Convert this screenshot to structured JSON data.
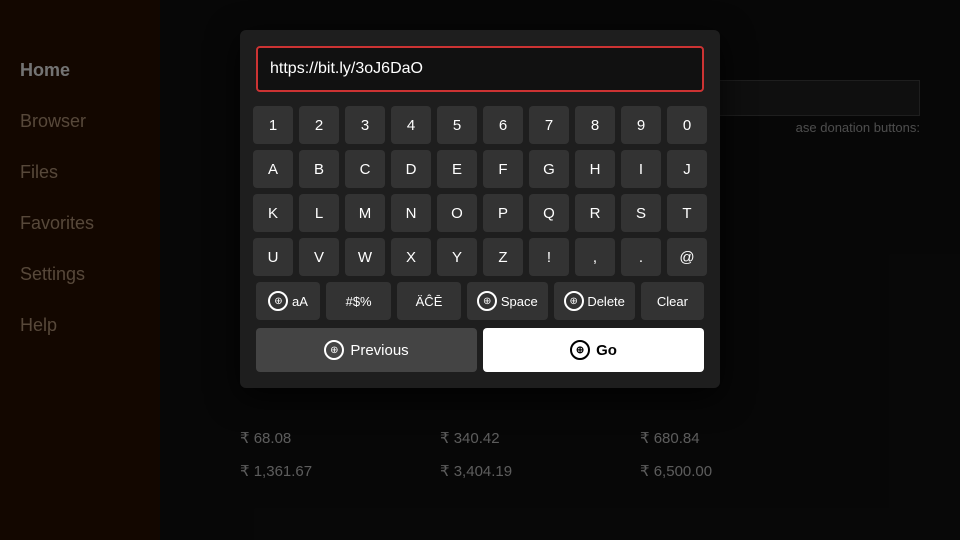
{
  "sidebar": {
    "items": [
      {
        "label": "Home",
        "active": true
      },
      {
        "label": "Browser",
        "active": false
      },
      {
        "label": "Files",
        "active": false
      },
      {
        "label": "Favorites",
        "active": false
      },
      {
        "label": "Settings",
        "active": false
      },
      {
        "label": "Help",
        "active": false
      }
    ]
  },
  "background": {
    "donation_label": "ase donation buttons:",
    "prices": [
      "₹ 68.08",
      "₹ 340.42",
      "₹ 680.84",
      "₹ 1,361.67",
      "₹ 3,404.19",
      "₹ 6,500.00"
    ]
  },
  "dialog": {
    "url_value": "https://bit.ly/3oJ6DaO",
    "keyboard": {
      "row1": [
        "1",
        "2",
        "3",
        "4",
        "5",
        "6",
        "7",
        "8",
        "9",
        "0"
      ],
      "row2": [
        "A",
        "B",
        "C",
        "D",
        "E",
        "F",
        "G",
        "H",
        "I",
        "J"
      ],
      "row3": [
        "K",
        "L",
        "M",
        "N",
        "O",
        "P",
        "Q",
        "R",
        "S",
        "T"
      ],
      "row4": [
        "U",
        "V",
        "W",
        "X",
        "Y",
        "Z",
        "!",
        ",",
        ".",
        "@"
      ],
      "special_keys": [
        {
          "label": "⊕ aA",
          "id": "case-toggle"
        },
        {
          "label": "#$%",
          "id": "symbols"
        },
        {
          "label": "ÄĈĒ",
          "id": "accents"
        },
        {
          "label": "⊕ Space",
          "id": "space"
        },
        {
          "label": "⊕ Delete",
          "id": "delete"
        },
        {
          "label": "Clear",
          "id": "clear"
        }
      ]
    },
    "previous_label": "Previous",
    "go_label": "Go"
  }
}
